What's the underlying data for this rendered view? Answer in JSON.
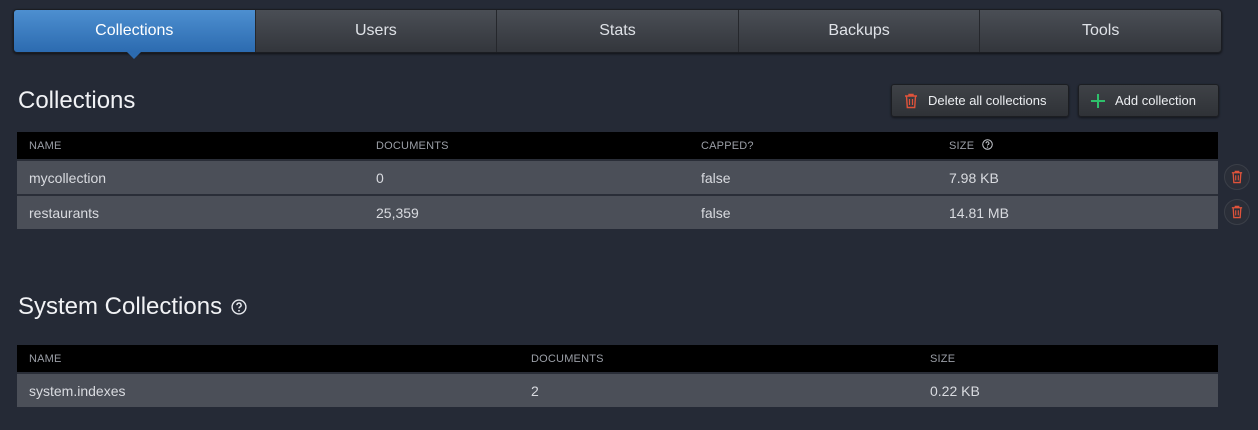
{
  "tabs": [
    {
      "label": "Collections",
      "active": true
    },
    {
      "label": "Users",
      "active": false
    },
    {
      "label": "Stats",
      "active": false
    },
    {
      "label": "Backups",
      "active": false
    },
    {
      "label": "Tools",
      "active": false
    }
  ],
  "collections": {
    "title": "Collections",
    "delete_all_label": "Delete all collections",
    "add_label": "Add collection",
    "columns": [
      "NAME",
      "DOCUMENTS",
      "CAPPED?",
      "SIZE"
    ],
    "rows": [
      {
        "name": "mycollection",
        "documents": "0",
        "capped": "false",
        "size": "7.98 KB"
      },
      {
        "name": "restaurants",
        "documents": "25,359",
        "capped": "false",
        "size": "14.81 MB"
      }
    ]
  },
  "system_collections": {
    "title": "System Collections",
    "columns": [
      "NAME",
      "DOCUMENTS",
      "SIZE"
    ],
    "rows": [
      {
        "name": "system.indexes",
        "documents": "2",
        "size": "0.22 KB"
      }
    ]
  },
  "colors": {
    "accent": "#2c6bb0",
    "danger": "#e0533b",
    "add": "#2ec06b",
    "background": "#252a36"
  },
  "icons": {
    "delete_all": "trash-icon",
    "add": "plus-icon",
    "row_delete": "trash-icon",
    "help": "question-circle-icon"
  }
}
